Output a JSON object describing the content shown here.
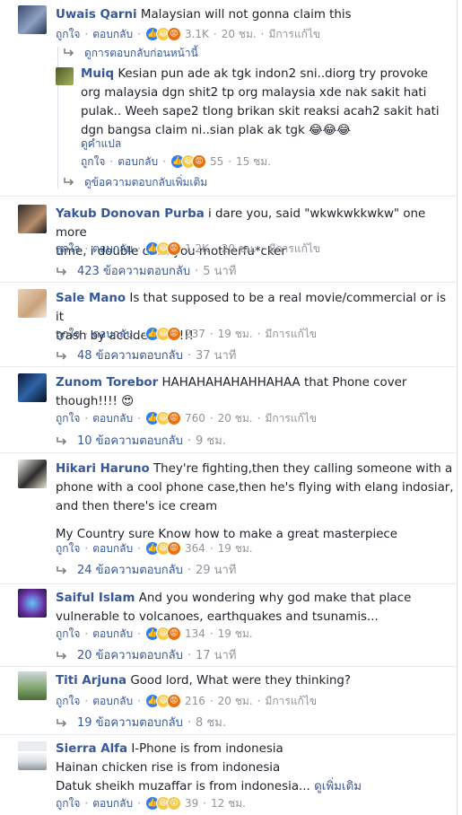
{
  "comments": [
    {
      "name": "Uwais Qarni",
      "text": "Malaysian will not gonna claim this",
      "like": "ถูกใจ",
      "reply": "ตอบกลับ",
      "count": "3.1K",
      "time": "20 ชม.",
      "edited": "มีการแก้ไข",
      "prev_replies": "ดูการตอบกลับก่อนหน้านี้",
      "more_replies": "ดูข้อความตอบกลับเพิ่มเติม",
      "reply_item": {
        "name": "Muiq",
        "line1": "Kesian pun ade ak tgk indon2 sni..diorg try provoke",
        "line2": "org malaysia dgn shit2 tp org malaysia xde nak sakit hati",
        "line3": "pulak.. Weeh sape2 tlong brikan skit reaksi acah2 sakit hati",
        "line4": "dgn bangsa claim ni..sian plak ak tgk 😂😂😂",
        "translate": "ดูคำแปล",
        "like": "ถูกใจ",
        "reply": "ตอบกลับ",
        "count": "55",
        "time": "15 ชม."
      }
    },
    {
      "name": "Yakub Donovan Purba",
      "line1": "i dare you, said \"wkwkwkkwkw\" one more",
      "line2": "time, i double dare you motherfu*cker",
      "like": "ถูกใจ",
      "reply": "ตอบกลับ",
      "count": "1.2K",
      "time": "20 ชม.",
      "edited": "มีการแก้ไข",
      "replies": "423 ข้อความตอบกลับ",
      "replies_time": "5 นาที"
    },
    {
      "name": "Sale Mano",
      "line1": "Is that supposed to be a real movie/commercial or is it",
      "line2": "trash by accident???!!!",
      "like": "ถูกใจ",
      "reply": "ตอบกลับ",
      "count": "237",
      "time": "19 ชม.",
      "edited": "มีการแก้ไข",
      "replies": "48 ข้อความตอบกลับ",
      "replies_time": "37 นาที"
    },
    {
      "name": "Zunom Torebor",
      "line1": "HAHAHAHAHAHHAHAA that Phone cover",
      "line2": "though!!!! 😍",
      "like": "ถูกใจ",
      "reply": "ตอบกลับ",
      "count": "760",
      "time": "20 ชม.",
      "edited": "มีการแก้ไข",
      "replies": "10 ข้อความตอบกลับ",
      "replies_time": "9 ชม."
    },
    {
      "name": "Hikari Haruno",
      "line1": "They're fighting,then they calling someone with a",
      "line2": "phone with a cool phone case,then he's flying with elang indosiar,",
      "line3": "and then there's ice cream",
      "line4": "My Country sure Know how to make a great masterpiece",
      "like": "ถูกใจ",
      "reply": "ตอบกลับ",
      "count": "364",
      "time": "19 ชม.",
      "replies": "24 ข้อความตอบกลับ",
      "replies_time": "29 นาที"
    },
    {
      "name": "Saiful Islam",
      "line1": "And you wondering why god make that place",
      "line2": "vulnerable to volcanoes, earthquakes and tsunamis...",
      "like": "ถูกใจ",
      "reply": "ตอบกลับ",
      "count": "134",
      "time": "19 ชม.",
      "replies": "20 ข้อความตอบกลับ",
      "replies_time": "17 นาที"
    },
    {
      "name": "Titi Arjuna",
      "line1": "Good lord, What were they thinking?",
      "like": "ถูกใจ",
      "reply": "ตอบกลับ",
      "count": "216",
      "time": "20 ชม.",
      "edited": "มีการแก้ไข",
      "replies": "19 ข้อความตอบกลับ",
      "replies_time": "8 ชม."
    },
    {
      "name": "Sierra Alfa",
      "line1": "I-Phone is from indonesia",
      "line2": "Hainan chicken rise is from indonesia",
      "line3": "Datuk sheikh muzaffar is from indonesia...",
      "see_more": "ดูเพิ่มเติม",
      "like": "ถูกใจ",
      "reply": "ตอบกลับ",
      "count": "39",
      "time": "12 ชม."
    }
  ]
}
